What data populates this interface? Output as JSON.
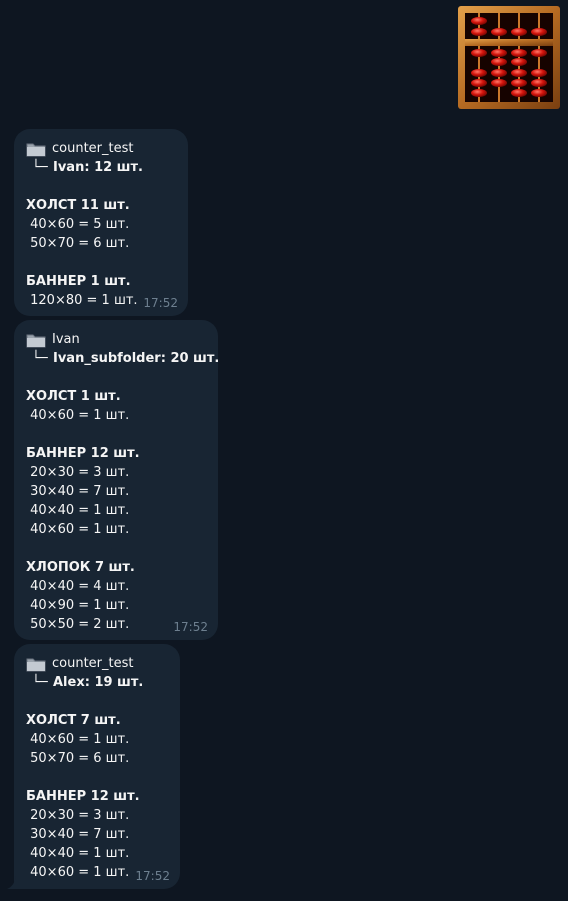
{
  "sticker": {
    "icon": "abacus-icon"
  },
  "messages": [
    {
      "folder": "counter_test",
      "sub": "Ivan: 12 шт.",
      "groups": [
        {
          "title": "ХОЛСТ 11 шт.",
          "items": [
            "40×60 = 5 шт.",
            "50×70 = 6 шт."
          ]
        },
        {
          "title": "БАННЕР 1 шт.",
          "items": [
            "120×80 = 1 шт."
          ]
        }
      ],
      "time": "17:52"
    },
    {
      "folder": "Ivan",
      "sub": "Ivan_subfolder: 20 шт.",
      "groups": [
        {
          "title": "ХОЛСТ 1 шт.",
          "items": [
            "40×60 = 1 шт."
          ]
        },
        {
          "title": "БАННЕР 12 шт.",
          "items": [
            "20×30 = 3 шт.",
            "30×40 = 7 шт.",
            "40×40 = 1 шт.",
            "40×60 = 1 шт."
          ]
        },
        {
          "title": "ХЛОПОК 7 шт.",
          "items": [
            "40×40 = 4 шт.",
            "40×90 = 1 шт.",
            "50×50 = 2 шт."
          ]
        }
      ],
      "time": "17:52"
    },
    {
      "folder": "counter_test",
      "sub": "Alex: 19 шт.",
      "groups": [
        {
          "title": "ХОЛСТ 7 шт.",
          "items": [
            "40×60 = 1 шт.",
            "50×70 = 6 шт."
          ]
        },
        {
          "title": "БАННЕР 12 шт.",
          "items": [
            "20×30 = 3 шт.",
            "30×40 = 7 шт.",
            "40×40 = 1 шт.",
            "40×60 = 1 шт."
          ]
        }
      ],
      "time": "17:52"
    }
  ]
}
